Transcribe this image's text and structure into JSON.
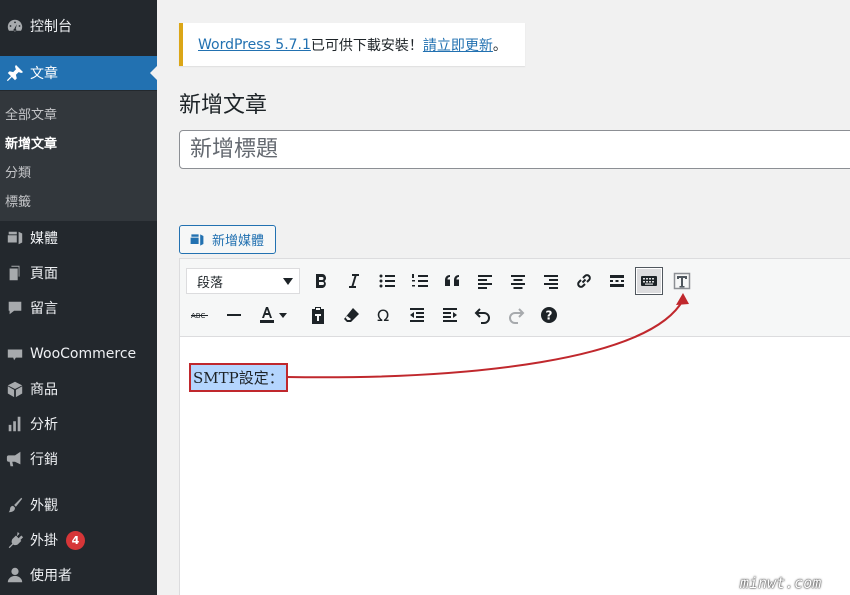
{
  "sidebar": {
    "dashboard": "控制台",
    "posts": "文章",
    "submenu": [
      "全部文章",
      "新增文章",
      "分類",
      "標籤"
    ],
    "media": "媒體",
    "pages": "頁面",
    "comments": "留言",
    "woocommerce": "WooCommerce",
    "products": "商品",
    "analytics": "分析",
    "marketing": "行銷",
    "appearance": "外觀",
    "plugins": "外掛",
    "plugins_badge": "4",
    "users": "使用者",
    "accent_color": "#2271b1",
    "badge_color": "#d63638"
  },
  "notice": {
    "version_link": "WordPress 5.7.1",
    "text": " 已可供下載安裝！",
    "update_link": "請立即更新",
    "end": "。"
  },
  "page": {
    "title": "新增文章",
    "title_placeholder": "新增標題",
    "add_media": "新增媒體"
  },
  "editor": {
    "format_select": "段落",
    "toolbar_row1_icons": [
      "bold-icon",
      "italic-icon",
      "bullet-list-icon",
      "numbered-list-icon",
      "blockquote-icon",
      "align-left-icon",
      "align-center-icon",
      "align-right-icon",
      "link-icon",
      "read-more-icon",
      "toolbar-toggle-icon",
      "text-tab-icon"
    ],
    "toolbar_row2_icons": [
      "strikethrough-icon",
      "horizontal-line-icon",
      "text-color-icon",
      "paste-as-text-icon",
      "clear-formatting-icon",
      "special-character-icon",
      "outdent-icon",
      "indent-icon",
      "undo-icon",
      "redo-icon",
      "help-icon"
    ],
    "content": "SMTP設定："
  },
  "watermark": "minwt.com"
}
